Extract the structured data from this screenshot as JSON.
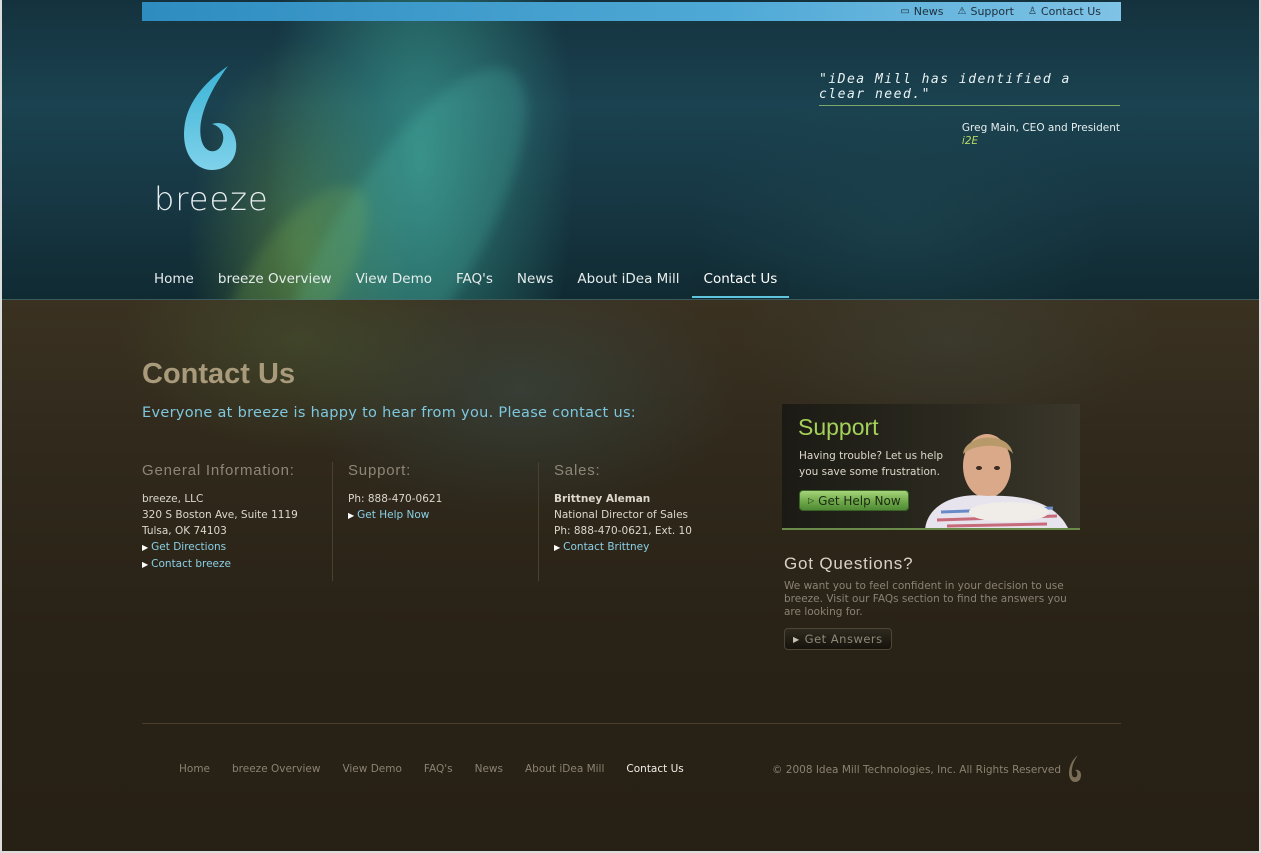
{
  "topbar": {
    "links": [
      {
        "label": "News",
        "icon": "comment-icon"
      },
      {
        "label": "Support",
        "icon": "warning-icon"
      },
      {
        "label": "Contact Us",
        "icon": "person-icon"
      }
    ]
  },
  "brand": {
    "name": "breeze"
  },
  "testimonial": {
    "quote": "\"iDea Mill has identified a clear need.\"",
    "author": "Greg Main, CEO and President",
    "org": "i2E"
  },
  "nav": {
    "items": [
      "Home",
      "breeze Overview",
      "View Demo",
      "FAQ's",
      "News",
      "About iDea Mill",
      "Contact Us"
    ],
    "active": "Contact Us"
  },
  "page": {
    "title": "Contact Us",
    "intro": "Everyone at breeze is happy to hear from you. Please contact us:"
  },
  "general": {
    "heading": "General Information:",
    "lines": [
      "breeze, LLC",
      "320 S Boston Ave, Suite 1119",
      "Tulsa, OK 74103"
    ],
    "links": [
      "Get Directions",
      "Contact breeze"
    ]
  },
  "support_col": {
    "heading": "Support:",
    "phone": "Ph: 888-470-0621",
    "link": "Get Help Now"
  },
  "sales": {
    "heading": "Sales:",
    "name": "Brittney Aleman",
    "title": "National Director of Sales",
    "phone": "Ph: 888-470-0621, Ext. 10",
    "link": "Contact Brittney"
  },
  "support_box": {
    "title": "Support",
    "text": "Having trouble? Let us help you save some frustration.",
    "button": "Get Help Now"
  },
  "questions": {
    "title": "Got Questions?",
    "text": "We want you to feel confident in your decision to use breeze. Visit our FAQs section to find the answers you are looking for.",
    "button": "Get Answers"
  },
  "footer": {
    "links": [
      "Home",
      "breeze Overview",
      "View Demo",
      "FAQ's",
      "News",
      "About iDea Mill",
      "Contact Us"
    ],
    "active": "Contact Us",
    "copyright": "© 2008 Idea Mill Technologies, Inc. All Rights Reserved"
  },
  "colors": {
    "accent_blue": "#7dc7df",
    "accent_green": "#a3d15a",
    "brown_bg": "#2a2218"
  }
}
